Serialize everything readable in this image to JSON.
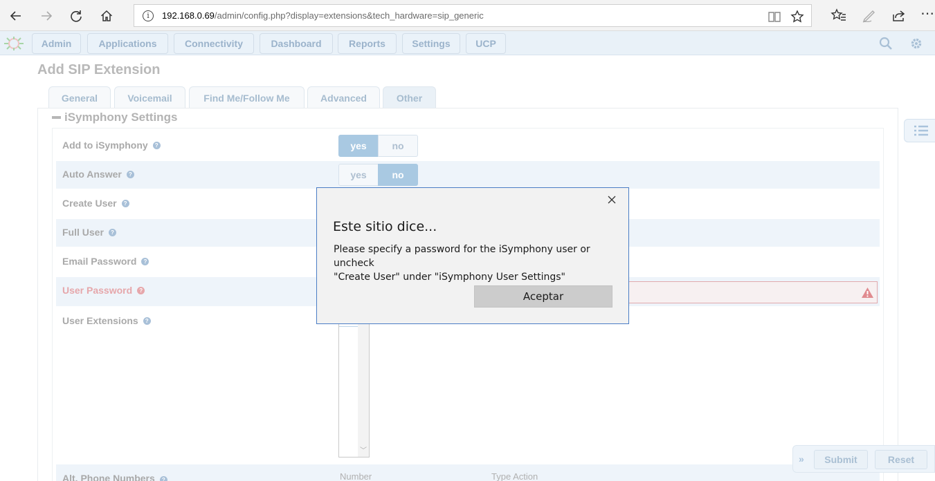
{
  "browser": {
    "url_host": "192.168.0.69",
    "url_rest": "/admin/config.php?display=extensions&tech_hardware=sip_generic"
  },
  "appnav": {
    "tabs": [
      "Admin",
      "Applications",
      "Connectivity",
      "Dashboard",
      "Reports",
      "Settings",
      "UCP"
    ]
  },
  "page": {
    "title": "Add SIP Extension",
    "tabs": [
      "General",
      "Voicemail",
      "Find Me/Follow Me",
      "Advanced",
      "Other"
    ],
    "active_tab": "Other",
    "section_title": "iSymphony Settings"
  },
  "fields": {
    "add_to_isymphony": {
      "label": "Add to iSymphony",
      "yes": "yes",
      "no": "no",
      "value": "yes"
    },
    "auto_answer": {
      "label": "Auto Answer",
      "yes": "yes",
      "no": "no",
      "value": "no"
    },
    "create_user": {
      "label": "Create User"
    },
    "full_user": {
      "label": "Full User"
    },
    "email_password": {
      "label": "Email Password"
    },
    "user_password": {
      "label": "User Password",
      "value": ""
    },
    "user_extensions": {
      "label": "User Extensions"
    },
    "alt_phone_numbers": {
      "label": "Alt. Phone Numbers",
      "col_number": "Number",
      "col_type_action": "Type Action"
    }
  },
  "actions": {
    "submit": "Submit",
    "reset": "Reset"
  },
  "dialog": {
    "title": "Este sitio dice...",
    "line1": "Please specify a password for the iSymphony user or uncheck",
    "line2": "\"Create User\" under \"iSymphony User Settings\"",
    "button": "Aceptar"
  }
}
